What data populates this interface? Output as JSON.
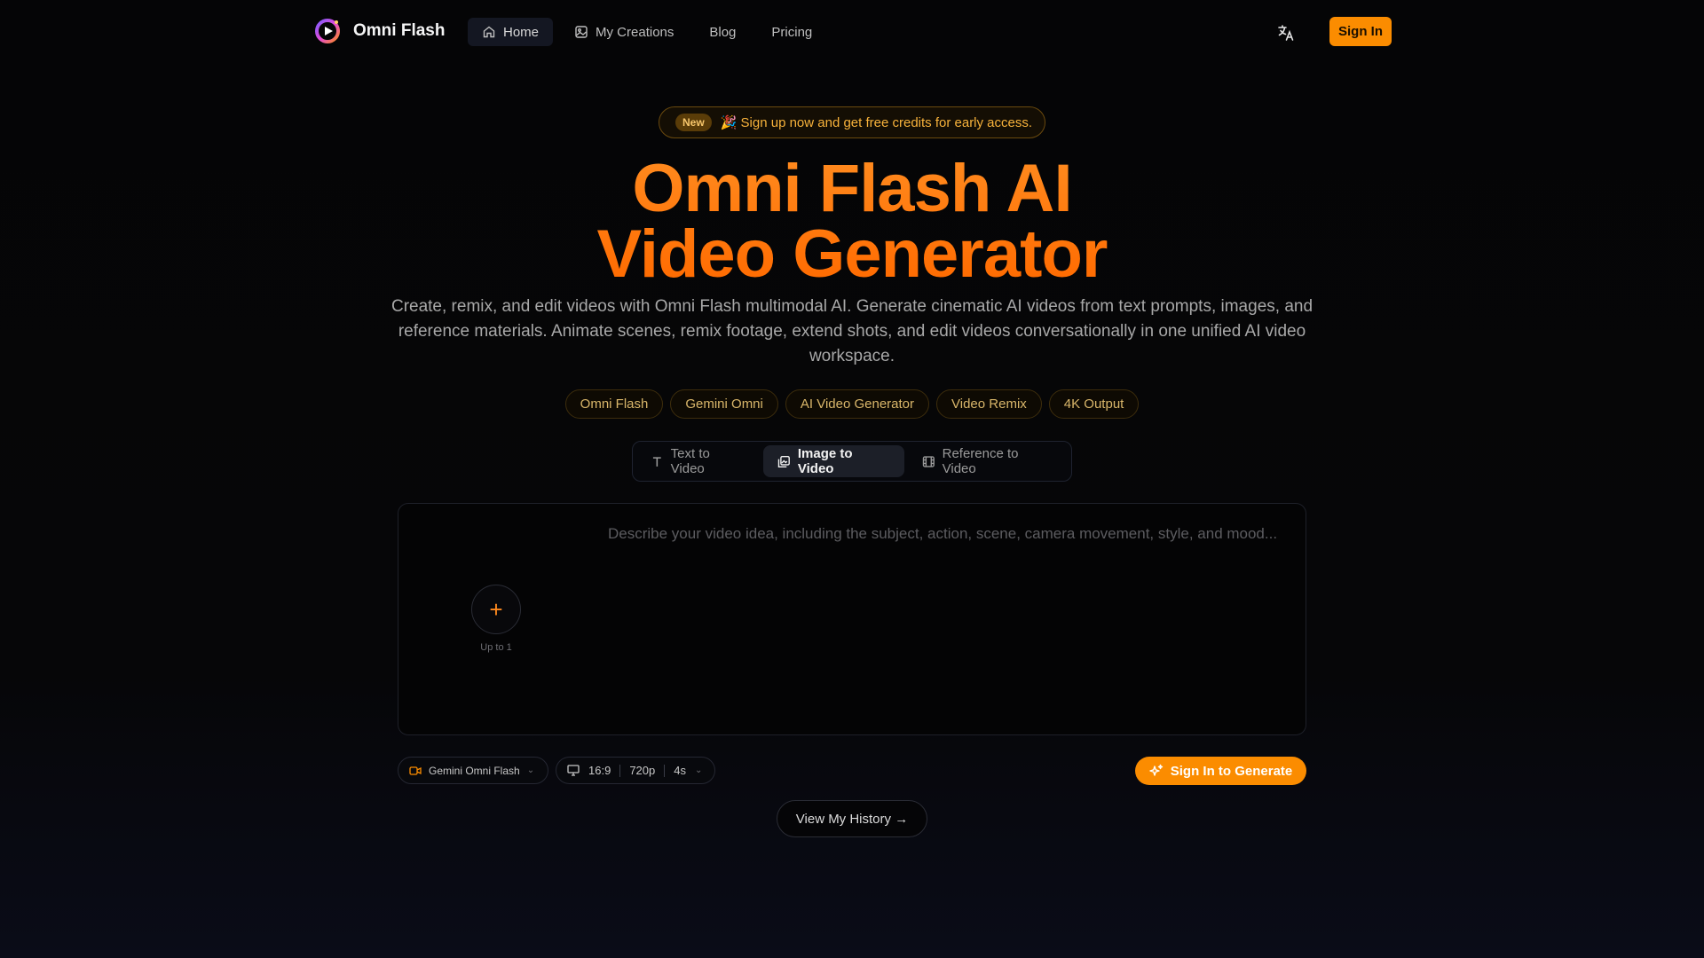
{
  "nav": {
    "brand": "Omni Flash",
    "links": [
      {
        "label": "Home",
        "icon": "home-icon",
        "active": true
      },
      {
        "label": "My Creations",
        "icon": "image-icon",
        "active": false
      },
      {
        "label": "Blog"
      },
      {
        "label": "Pricing"
      }
    ],
    "sign_in": "Sign In"
  },
  "announcement": {
    "badge": "New",
    "text": "🎉 Sign up now and get free credits for early access."
  },
  "hero": {
    "title_line1": "Omni Flash AI",
    "title_line2": "Video Generator",
    "description": "Create, remix, and edit videos with Omni Flash multimodal AI. Generate cinematic AI videos from text prompts, images, and reference materials. Animate scenes, remix footage, extend shots, and edit videos conversationally in one unified AI video workspace.",
    "tags": [
      "Omni Flash",
      "Gemini Omni",
      "AI Video Generator",
      "Video Remix",
      "4K Output"
    ]
  },
  "modes": {
    "items": [
      {
        "label": "Text to Video",
        "icon": "text-icon"
      },
      {
        "label": "Image to Video",
        "icon": "image-stack-icon"
      },
      {
        "label": "Reference to Video",
        "icon": "film-icon"
      }
    ],
    "active_index": 1
  },
  "prompt": {
    "placeholder": "Describe your video idea, including the subject, action, scene, camera movement, style, and mood...",
    "upload_label": "Up to 1"
  },
  "controls": {
    "model": "Gemini Omni Flash",
    "aspect": "16:9",
    "resolution": "720p",
    "duration": "4s",
    "generate": "Sign In to Generate",
    "history": "View My History →"
  },
  "colors": {
    "accent": "#fb8c00",
    "title_gradient": [
      "#ff8a1e",
      "#ff6a00"
    ]
  }
}
